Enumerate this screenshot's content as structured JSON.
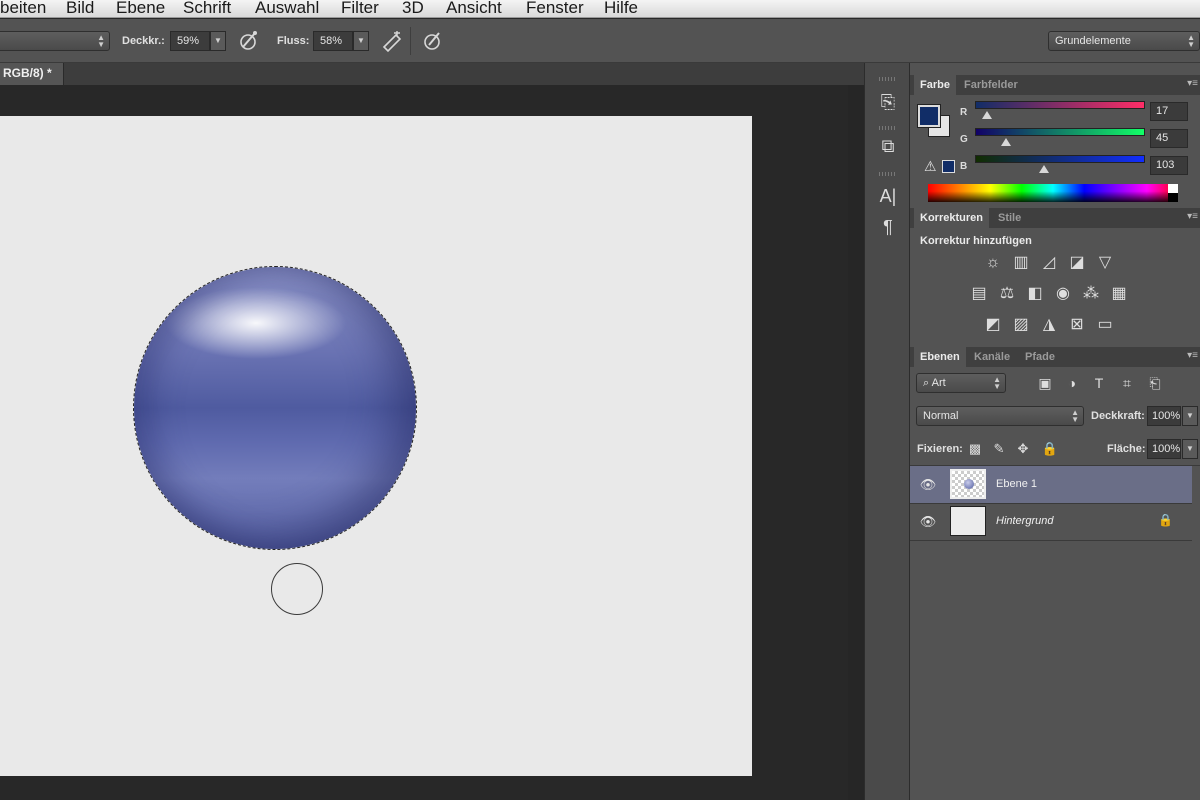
{
  "menu": [
    "beiten",
    "Bild",
    "Ebene",
    "Schrift",
    "Auswahl",
    "Filter",
    "3D",
    "Ansicht",
    "Fenster",
    "Hilfe"
  ],
  "options": {
    "opacity_label": "Deckkr.:",
    "opacity_value": "59%",
    "flow_label": "Fluss:",
    "flow_value": "58%",
    "workspace": "Grundelemente"
  },
  "document": {
    "tab_title": "RGB/8) *"
  },
  "color_panel": {
    "tabs": [
      "Farbe",
      "Farbfelder"
    ],
    "foreground_color": "#112d67",
    "channels": [
      {
        "label": "R",
        "value": "17"
      },
      {
        "label": "G",
        "value": "45"
      },
      {
        "label": "B",
        "value": "103"
      }
    ]
  },
  "adjustments_panel": {
    "tabs": [
      "Korrekturen",
      "Stile"
    ],
    "title": "Korrektur hinzufügen"
  },
  "layers_panel": {
    "tabs": [
      "Ebenen",
      "Kanäle",
      "Pfade"
    ],
    "filter_kind": "Art",
    "blend_mode": "Normal",
    "opacity_label": "Deckkraft:",
    "opacity_value": "100%",
    "lock_label": "Fixieren:",
    "fill_label": "Fläche:",
    "fill_value": "100%",
    "layers": [
      {
        "name": "Ebene 1",
        "selected": true
      },
      {
        "name": "Hintergrund",
        "selected": false,
        "locked": true
      }
    ]
  }
}
